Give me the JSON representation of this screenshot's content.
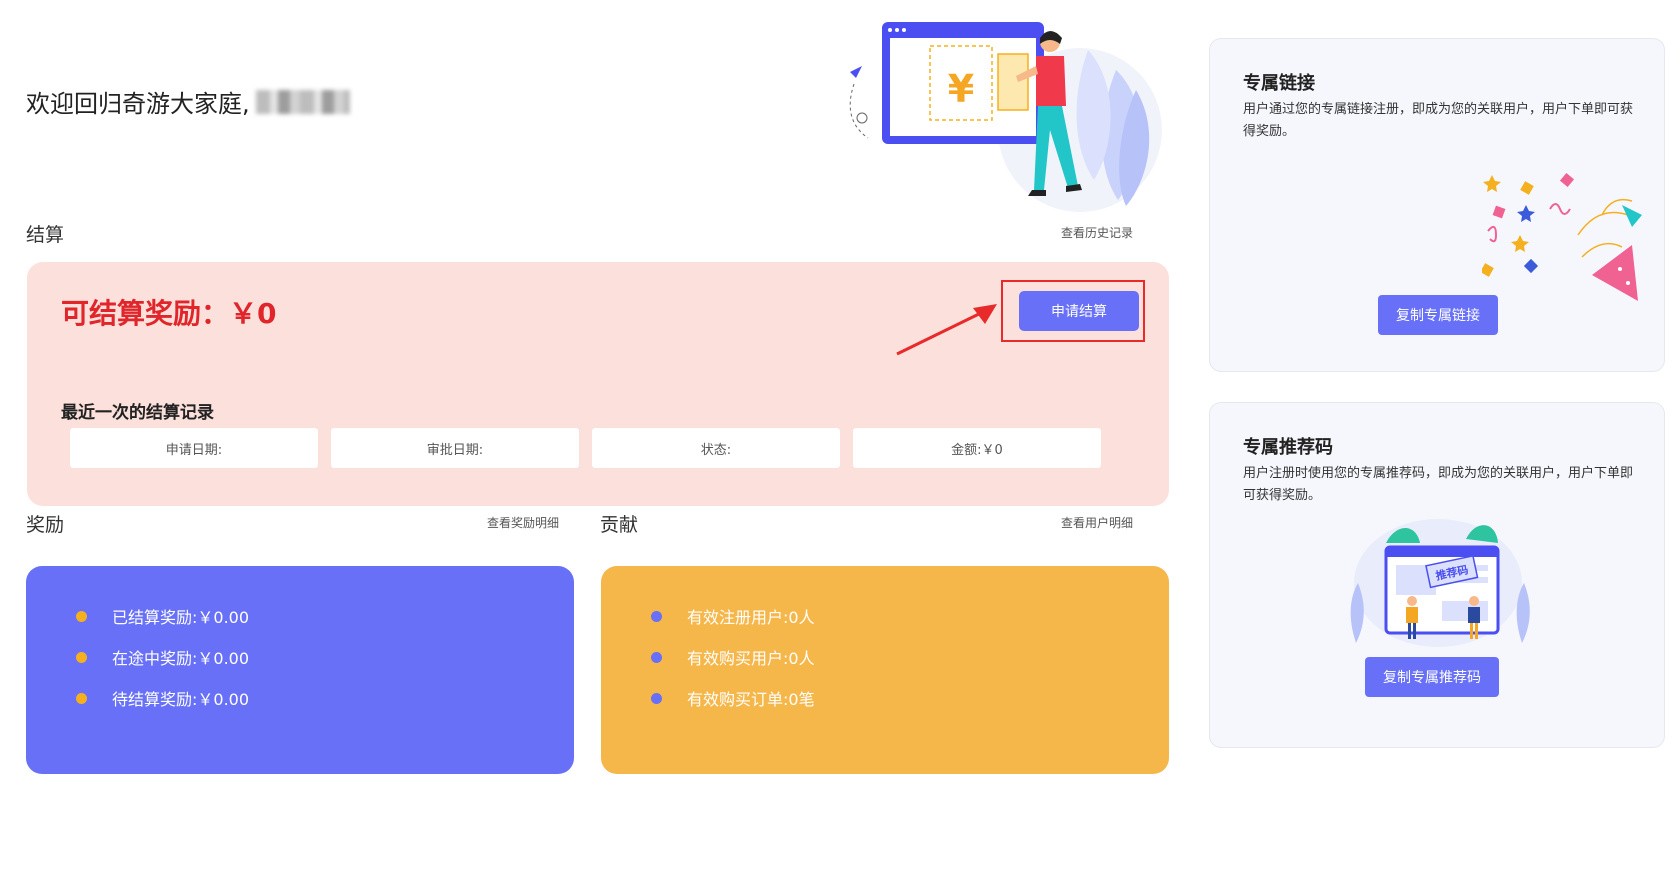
{
  "welcome": {
    "text": "欢迎回归奇游大家庭,"
  },
  "hero_illustration": {
    "currency_symbol": "¥"
  },
  "settlement": {
    "section_title": "结算",
    "history_link": "查看历史记录",
    "available_label": "可结算奖励：￥0",
    "apply_button": "申请结算",
    "last_record_title": "最近一次的结算记录",
    "records": [
      {
        "label": "申请日期:"
      },
      {
        "label": "审批日期:"
      },
      {
        "label": "状态:"
      },
      {
        "label": "金额:￥0"
      }
    ]
  },
  "rewards": {
    "section_title": "奖励",
    "detail_link": "查看奖励明细",
    "card_color": "#6770f7",
    "dot_color": "#f5b01f",
    "items": [
      {
        "text": "已结算奖励:￥0.00"
      },
      {
        "text": "在途中奖励:￥0.00"
      },
      {
        "text": "待结算奖励:￥0.00"
      }
    ]
  },
  "contribution": {
    "section_title": "贡献",
    "detail_link": "查看用户明细",
    "card_color": "#f6b74a",
    "dot_color": "#6770f7",
    "items": [
      {
        "text": "有效注册用户:0人"
      },
      {
        "text": "有效购买用户:0人"
      },
      {
        "text": "有效购买订单:0笔"
      }
    ]
  },
  "exclusive_link": {
    "title": "专属链接",
    "description": "用户通过您的专属链接注册，即成为您的关联用户，用户下单即可获得奖励。",
    "button": "复制专属链接"
  },
  "referral_code": {
    "title": "专属推荐码",
    "description": "用户注册时使用您的专属推荐码，即成为您的关联用户，用户下单即可获得奖励。",
    "button": "复制专属推荐码",
    "illustration_label": "推荐码"
  },
  "colors": {
    "primary": "#6770f7",
    "danger": "#e0262a",
    "settle_bg": "#fbe0dc"
  }
}
